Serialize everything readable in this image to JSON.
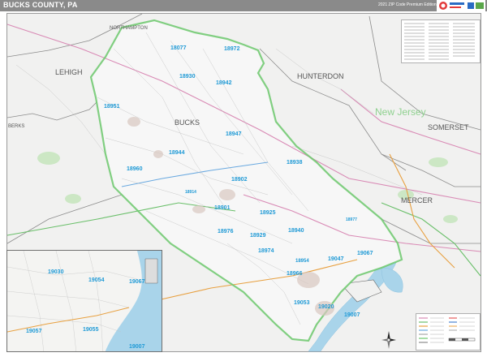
{
  "header": {
    "title": "BUCKS COUNTY, PA",
    "edition": "2021 ZIP Code Premium Edition"
  },
  "labels": {
    "regions": {
      "northampton": "NORTHAMPTON",
      "lehigh": "LEHIGH",
      "hunterdon": "HUNTERDON",
      "new_jersey": "New Jersey",
      "somerset": "SOMERSET",
      "bucks": "BUCKS",
      "berks": "BERKS",
      "mercer": "MERCER"
    },
    "zip_codes": {
      "z18077": "18077",
      "z18972": "18972",
      "z18930": "18930",
      "z18942": "18942",
      "z18951": "18951",
      "z18947": "18947",
      "z18944": "18944",
      "z18938": "18938",
      "z18960": "18960",
      "z18902": "18902",
      "z18914": "18914",
      "z18901": "18901",
      "z18925": "18925",
      "z18977": "18977",
      "z18976": "18976",
      "z18929": "18929",
      "z18940": "18940",
      "z18974": "18974",
      "z18954": "18954",
      "z19047": "19047",
      "z19067": "19067",
      "z18966": "18966",
      "z19053": "19053",
      "z19020": "19020",
      "z19007": "19007"
    },
    "inset_zip_codes": {
      "z19030": "19030",
      "z19054": "19054",
      "z19067": "19067",
      "z19057": "19057",
      "z19055": "19055",
      "z19007": "19007"
    }
  },
  "colors": {
    "header_bg": "#8a8a8a",
    "county_border": "#6cc86c",
    "zip_label": "#1f9ad6",
    "region_label": "#555555",
    "state_label": "#8fd18f",
    "water": "#a9d4ea",
    "park": "#c8e6c0",
    "highway_pink": "#d98ab5",
    "highway_green": "#6abf6a",
    "highway_orange": "#e8a040",
    "highway_blue": "#6aa9e0",
    "road_gray": "#a8a8a8"
  },
  "icons": {
    "logo": "map-publisher-logo",
    "compass": "compass-rose-icon"
  }
}
